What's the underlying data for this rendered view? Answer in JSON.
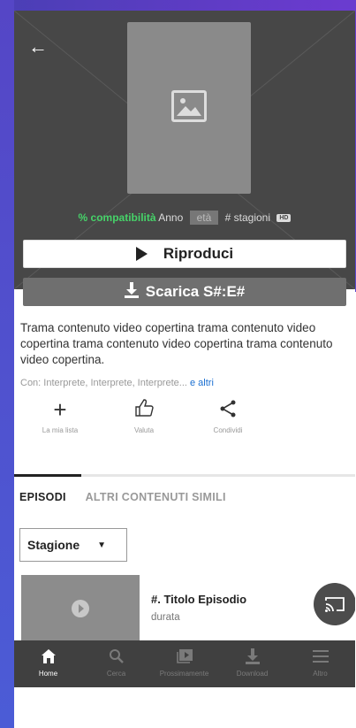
{
  "header": {
    "back_icon": "arrow-left-icon"
  },
  "meta": {
    "match": "% compatibilità",
    "year": "Anno",
    "age": "età",
    "seasons": "# stagioni",
    "quality": "HD"
  },
  "buttons": {
    "play": "Riproduci",
    "download": "Scarica S#:E#"
  },
  "description": "Trama contenuto video copertina trama contenuto video copertina trama contenuto video copertina trama contenuto video copertina.",
  "cast": {
    "prefix": "Con: Interprete, Interprete, Interprete...",
    "more": "e altri"
  },
  "actions": [
    {
      "label": "La mia lista",
      "icon": "plus-icon"
    },
    {
      "label": "Valuta",
      "icon": "thumbs-up-icon"
    },
    {
      "label": "Condividi",
      "icon": "share-icon"
    }
  ],
  "tabs": {
    "episodes": "EPISODI",
    "similar": "ALTRI CONTENUTI SIMILI"
  },
  "season_select": {
    "value": "Stagione"
  },
  "episode": {
    "title": "#. Titolo Episodio",
    "duration": "durata"
  },
  "tabbar": [
    {
      "label": "Home",
      "icon": "home-icon",
      "active": true
    },
    {
      "label": "Cerca",
      "icon": "search-icon",
      "active": false
    },
    {
      "label": "Prossimamente",
      "icon": "play-library-icon",
      "active": false
    },
    {
      "label": "Download",
      "icon": "download-icon",
      "active": false
    },
    {
      "label": "Altro",
      "icon": "menu-icon",
      "active": false
    }
  ],
  "colors": {
    "hero": "#474747",
    "match_green": "#46d369",
    "link_blue": "#1a6fd1",
    "tabbar": "#404040"
  }
}
